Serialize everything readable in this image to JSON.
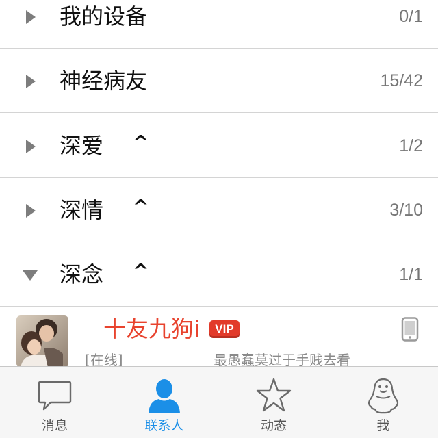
{
  "groups": [
    {
      "name": "我的设备",
      "mark": "",
      "count": "0/1",
      "expanded": false
    },
    {
      "name": "神经病友",
      "mark": "",
      "count": "15/42",
      "expanded": false
    },
    {
      "name": "深爱",
      "mark": "^",
      "count": "1/2",
      "expanded": false
    },
    {
      "name": "深情",
      "mark": "^",
      "count": "3/10",
      "expanded": false
    },
    {
      "name": "深念",
      "mark": "^",
      "count": "1/1",
      "expanded": true
    }
  ],
  "contact": {
    "name": "十友九狗i",
    "badge": "VIP",
    "status": "[在线]",
    "signature": "最愚蠢莫过于手贱去看"
  },
  "tabbar": {
    "tabs": [
      {
        "label": "消息",
        "icon": "chat-bubble-icon",
        "active": false
      },
      {
        "label": "联系人",
        "icon": "contacts-person-icon",
        "active": true
      },
      {
        "label": "动态",
        "icon": "star-icon",
        "active": false
      },
      {
        "label": "我",
        "icon": "penguin-icon",
        "active": false
      }
    ]
  },
  "colors": {
    "accent": "#1b8fe7",
    "name_red": "#e8432e",
    "vip_red": "#e23a2a",
    "divider": "#d4d4d4"
  }
}
